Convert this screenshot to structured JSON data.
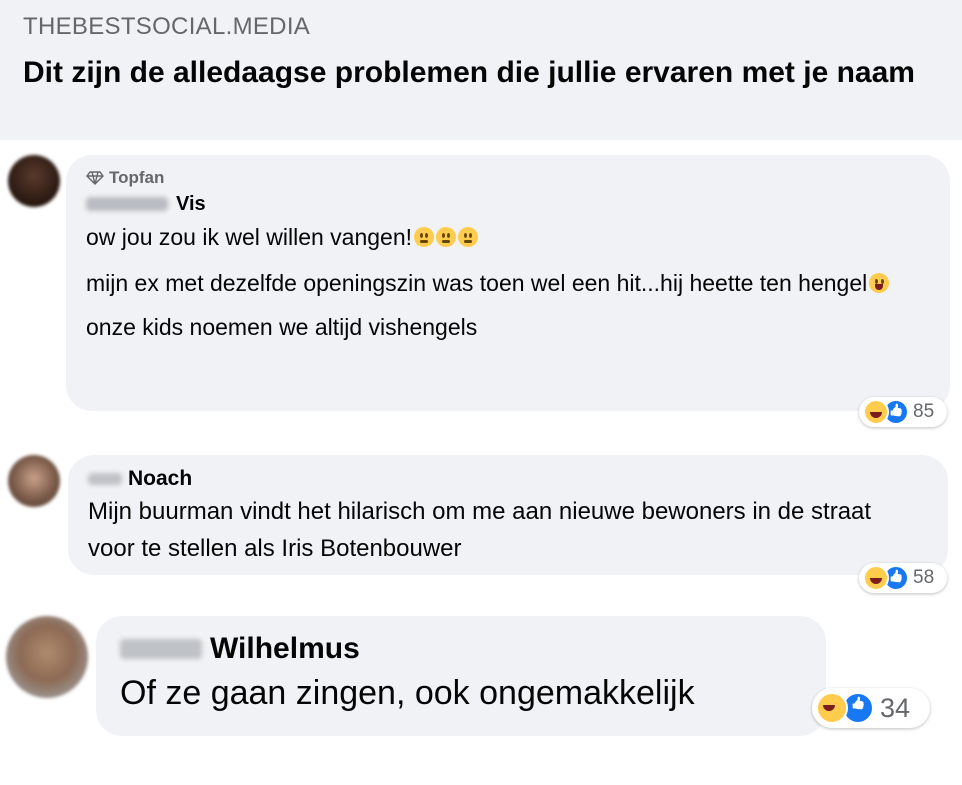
{
  "header": {
    "site": "THEBESTSOCIAL.MEDIA",
    "title": "Dit zijn de alledaagse problemen die jullie ervaren met je naam"
  },
  "comments": [
    {
      "badge": "Topfan",
      "badge_icon": "diamond-icon",
      "name": "Vis",
      "paragraphs": [
        "ow jou zou ik wel willen vangen!",
        "mijn ex met dezelfde openingszin was toen wel een hit...hij heette ten hengel",
        "onze kids noemen we altijd vishengels"
      ],
      "reactions": {
        "count": "85",
        "icons": [
          "haha",
          "like"
        ]
      }
    },
    {
      "name": "Noach",
      "paragraphs": [
        "Mijn buurman vindt het hilarisch om me aan nieuwe bewoners in de straat voor te stellen als Iris Botenbouwer"
      ],
      "reactions": {
        "count": "58",
        "icons": [
          "haha",
          "like"
        ]
      }
    },
    {
      "name": "Wilhelmus",
      "paragraphs": [
        "Of ze gaan zingen, ook ongemakkelijk"
      ],
      "reactions": {
        "count": "34",
        "icons": [
          "haha",
          "like"
        ]
      }
    }
  ],
  "colors": {
    "bubble": "#f0f2f5",
    "secondary_text": "#65676b",
    "like_blue": "#1877f2",
    "haha_yellow": "#ffcc4d"
  }
}
